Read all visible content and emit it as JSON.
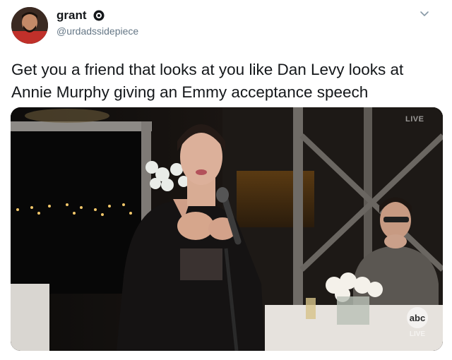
{
  "tweet": {
    "author_name": "grant",
    "author_handle": "@urdadssidepiece",
    "text": "Get you a friend that looks at you like Dan Levy looks at Annie Murphy giving an Emmy acceptance speech"
  },
  "media": {
    "live_badge": "LIVE",
    "network_logo_text": "abc",
    "network_live_text": "LIVE"
  },
  "icons": {
    "verified": "verified-badge-icon",
    "more": "chevron-down-icon"
  }
}
